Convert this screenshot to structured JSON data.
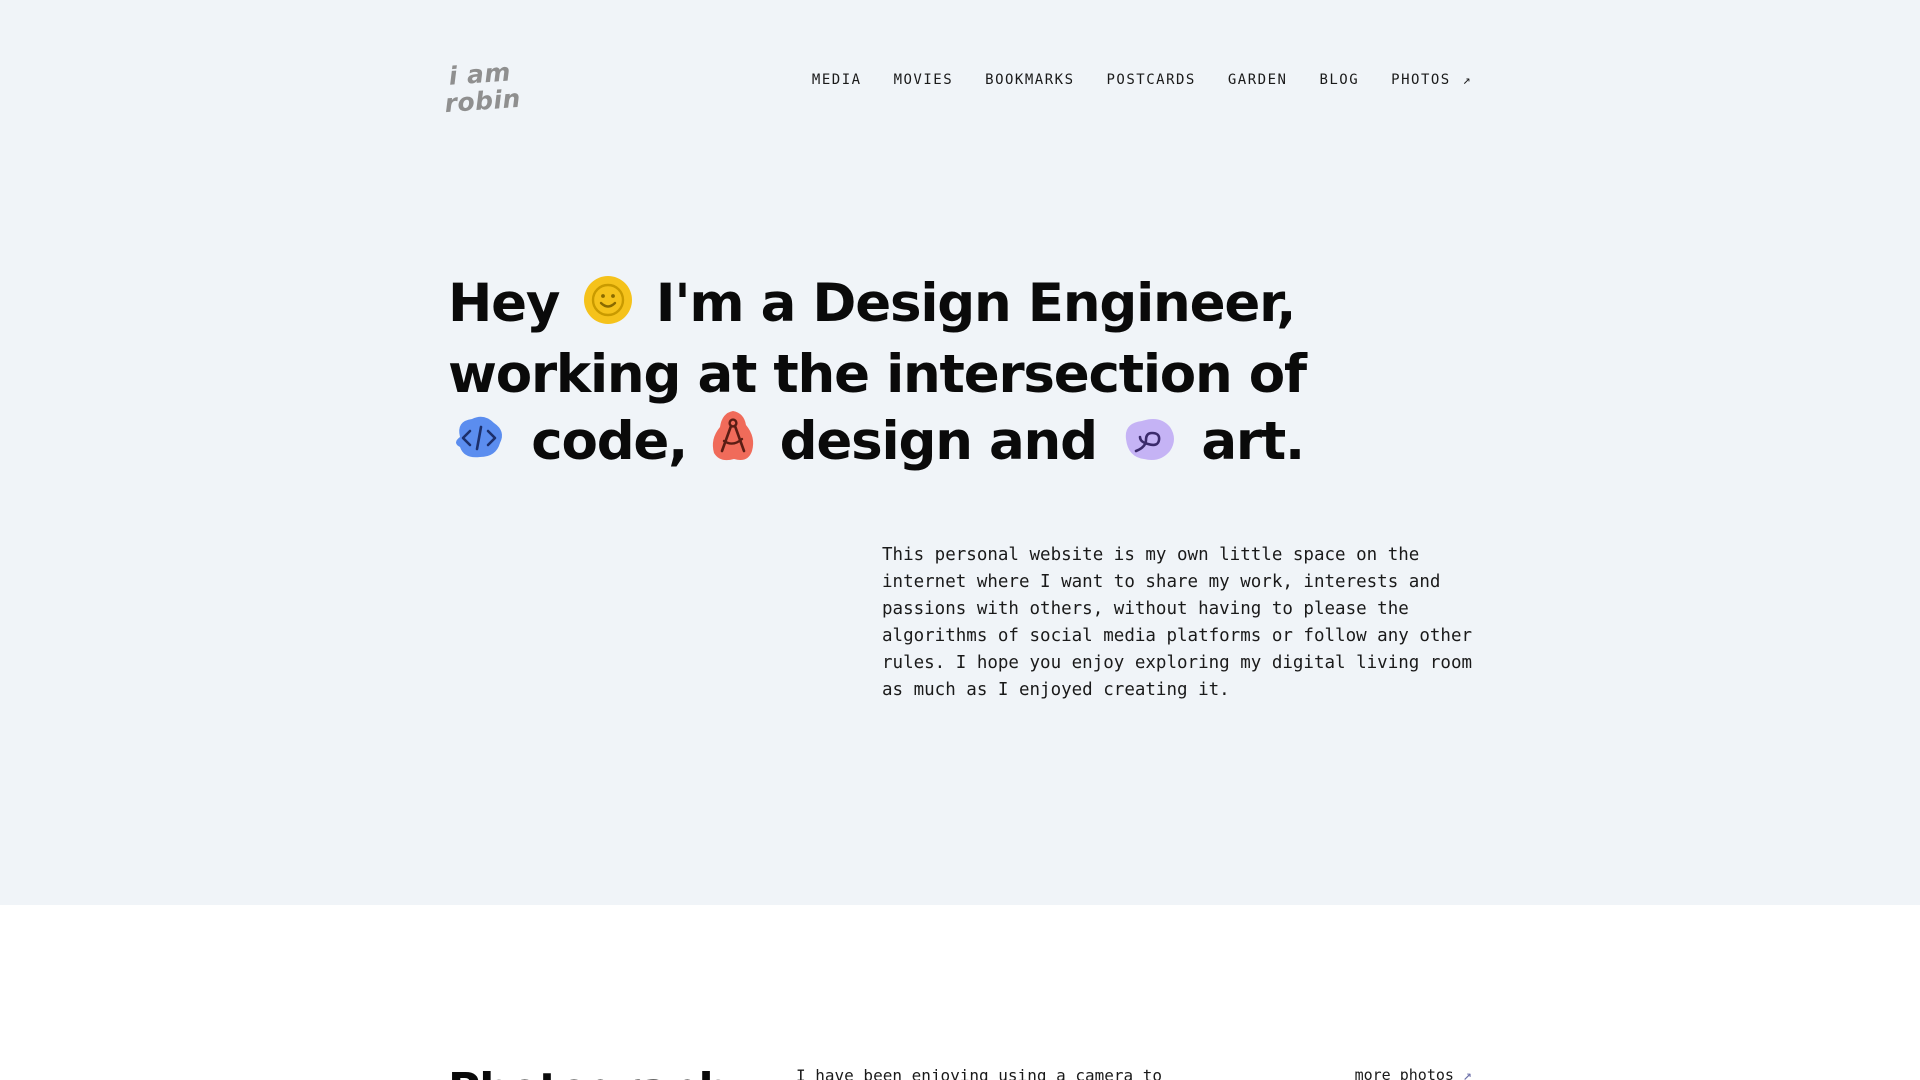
{
  "site": {
    "logo_line1": "i am",
    "logo_line2": "robin"
  },
  "nav": {
    "items": [
      {
        "label": "MEDIA"
      },
      {
        "label": "MOVIES"
      },
      {
        "label": "BOOKMARKS"
      },
      {
        "label": "POSTCARDS"
      },
      {
        "label": "GARDEN"
      },
      {
        "label": "BLOG"
      },
      {
        "label": "PHOTOS",
        "icon": "external-arrow-icon"
      }
    ],
    "external_arrow": "↗"
  },
  "hero": {
    "line1_pre": "Hey",
    "line1_post": "I'm a Design Engineer,",
    "line2": "working at the intersection of",
    "line3_word1": "code,",
    "line3_word2": "design and",
    "line3_word3": "art.",
    "icons": {
      "smiley": {
        "name": "smiley-icon",
        "color": "#f5c21b"
      },
      "code": {
        "name": "code-icon",
        "color": "#5b8def"
      },
      "compass": {
        "name": "compass-icon",
        "color": "#f06b5a"
      },
      "squiggle": {
        "name": "squiggle-icon",
        "color": "#c5b3f5"
      }
    }
  },
  "intro": {
    "text": "This personal website is my own little space on the internet where I want to share my work, interests and passions with others, without having to please the algorithms of social media platforms or follow any other rules. I hope you enjoy exploring my digital living room as much as I enjoyed creating it."
  },
  "photos_section": {
    "title": "Photography",
    "text": "I have been enjoying using a camera to",
    "more_label": "more photos",
    "more_arrow": "↗"
  },
  "colors": {
    "hero_background": "#f0f4f8",
    "page_background": "#ffffff",
    "text": "#0a0a0a",
    "logo": "#8f8f8f"
  }
}
